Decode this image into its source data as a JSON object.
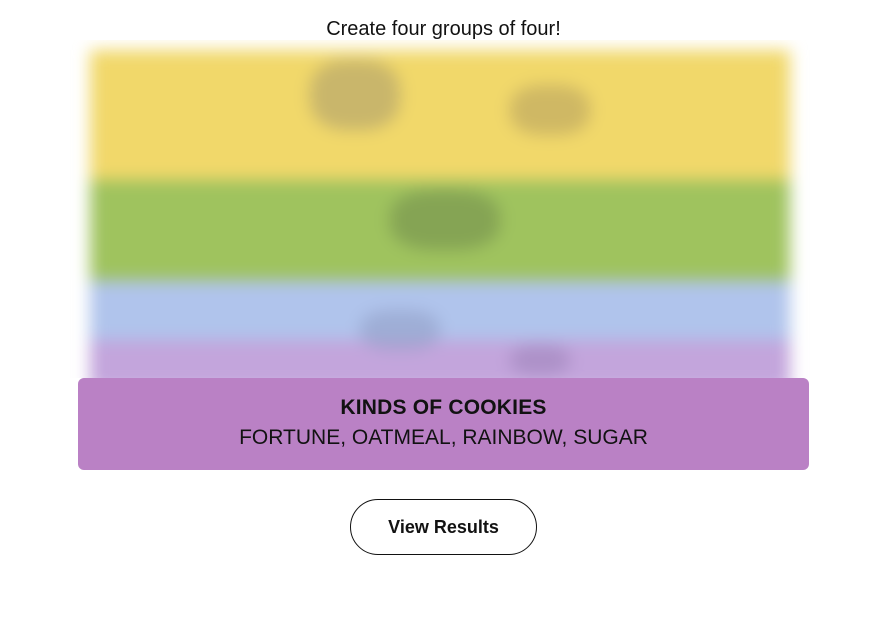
{
  "header": {
    "instructions": "Create four groups of four!"
  },
  "board": {
    "state": "blurred",
    "colors": {
      "yellow": "#f1d86a",
      "green": "#9fc35e",
      "blue": "#b0c4ec",
      "purple": "#c3a5dc"
    }
  },
  "solved_group": {
    "category": "KINDS OF COOKIES",
    "members": "FORTUNE, OATMEAL, RAINBOW, SUGAR",
    "color": "#ba81c5"
  },
  "actions": {
    "view_results_label": "View Results"
  }
}
